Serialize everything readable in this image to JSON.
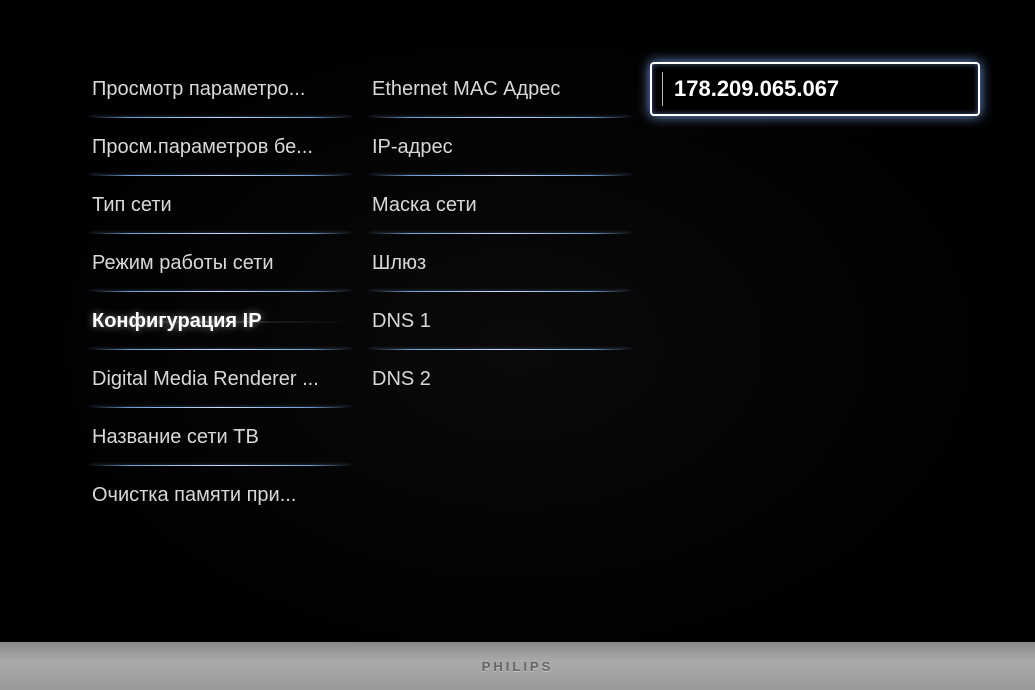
{
  "brand": "PHILIPS",
  "columns": {
    "left": {
      "selectedIndex": 4,
      "items": [
        {
          "label": "Просмотр параметро..."
        },
        {
          "label": "Просм.параметров бе..."
        },
        {
          "label": "Тип сети"
        },
        {
          "label": "Режим работы сети"
        },
        {
          "label": "Конфигурация IP"
        },
        {
          "label": "Digital Media Renderer ..."
        },
        {
          "label": "Название сети ТВ"
        },
        {
          "label": "Очистка памяти при..."
        }
      ]
    },
    "middle": {
      "items": [
        {
          "label": "Ethernet MAC Адрес"
        },
        {
          "label": "IP-адрес"
        },
        {
          "label": "Маска сети"
        },
        {
          "label": "Шлюз"
        },
        {
          "label": "DNS 1"
        },
        {
          "label": "DNS 2"
        }
      ]
    },
    "right": {
      "value": "178.209.065.067"
    }
  }
}
